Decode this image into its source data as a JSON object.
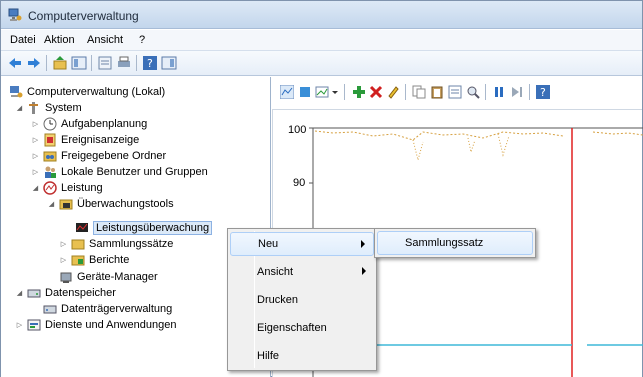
{
  "window": {
    "title": "Computerverwaltung"
  },
  "menubar": {
    "items": [
      "Datei",
      "Aktion",
      "Ansicht",
      "?"
    ]
  },
  "tree": {
    "root": "Computerverwaltung (Lokal)",
    "system": "System",
    "aufgabenplanung": "Aufgabenplanung",
    "ereignisanzeige": "Ereignisanzeige",
    "freigegebene_ordner": "Freigegebene Ordner",
    "lokale_benutzer": "Lokale Benutzer und Gruppen",
    "leistung": "Leistung",
    "ueberwachungstools": "Überwachungstools",
    "leistungsueberwachung": "Leistungsüberwachung",
    "sammlungssaetze": "Sammlungssätze",
    "berichte": "Berichte",
    "geraete_manager": "Geräte-Manager",
    "datenspeicher": "Datenspeicher",
    "datentraegerverwaltung": "Datenträgerverwaltung",
    "dienste": "Dienste und Anwendungen"
  },
  "graph": {
    "y_labels": [
      "100",
      "90"
    ]
  },
  "context_menu": {
    "items": [
      "Neu",
      "Ansicht",
      "Drucken",
      "Eigenschaften",
      "Hilfe"
    ]
  },
  "submenu": {
    "items": [
      "Sammlungssatz"
    ]
  },
  "colors": {
    "highlight": "#dfedfc",
    "accent_red": "#e02020",
    "accent_cyan": "#3fb8d8"
  }
}
